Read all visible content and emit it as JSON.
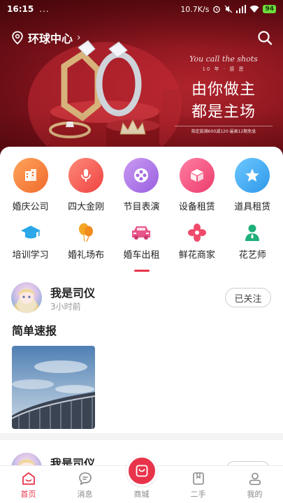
{
  "status_bar": {
    "time": "16:15",
    "dots": "...",
    "network_speed": "10.7K/s",
    "battery": "94"
  },
  "header": {
    "location": "环球中心",
    "location_chevron": "›",
    "search_icon": "search-icon"
  },
  "banner": {
    "script_text": "You call the shots",
    "sub_text": "10 年 · 感 恩",
    "headline_1": "由你做主",
    "headline_2": "都是主场",
    "note": "指定款满600减120·最高12期免息"
  },
  "categories": [
    {
      "label": "婚庆公司",
      "icon": "building-icon",
      "color": "#f47a3c"
    },
    {
      "label": "四大金刚",
      "icon": "microphone-icon",
      "color": "#f35a58"
    },
    {
      "label": "节目表演",
      "icon": "film-reel-icon",
      "color": "#b57be6"
    },
    {
      "label": "设备租赁",
      "icon": "box-icon",
      "color": "#f04f7c"
    },
    {
      "label": "道具租赁",
      "icon": "star-icon",
      "color": "#3aaef0"
    }
  ],
  "categories_row2": [
    {
      "label": "培训学习",
      "icon": "graduation-cap-icon",
      "color": "#2aa7e8"
    },
    {
      "label": "婚礼场布",
      "icon": "balloon-icon",
      "color": "#f5a623"
    },
    {
      "label": "婚车出租",
      "icon": "car-icon",
      "color": "#e8558a"
    },
    {
      "label": "鲜花商家",
      "icon": "flower-icon",
      "color": "#ef4a6a"
    },
    {
      "label": "花艺师",
      "icon": "florist-icon",
      "color": "#1fb07a"
    }
  ],
  "feed": {
    "post": {
      "username": "我是司仪",
      "time": "3小时前",
      "follow_label": "已关注",
      "title": "简单速报"
    },
    "post2": {
      "username": "我是司仪"
    }
  },
  "tabbar": {
    "items": [
      {
        "label": "首页",
        "icon": "home-icon",
        "active": true
      },
      {
        "label": "消息",
        "icon": "message-icon",
        "active": false
      },
      {
        "label": "商城",
        "icon": "shop-icon",
        "active": false
      },
      {
        "label": "二手",
        "icon": "bookmark-icon",
        "active": false
      },
      {
        "label": "我的",
        "icon": "user-icon",
        "active": false
      }
    ]
  },
  "colors": {
    "accent": "#e8344b",
    "banner_red": "#8e1720"
  }
}
